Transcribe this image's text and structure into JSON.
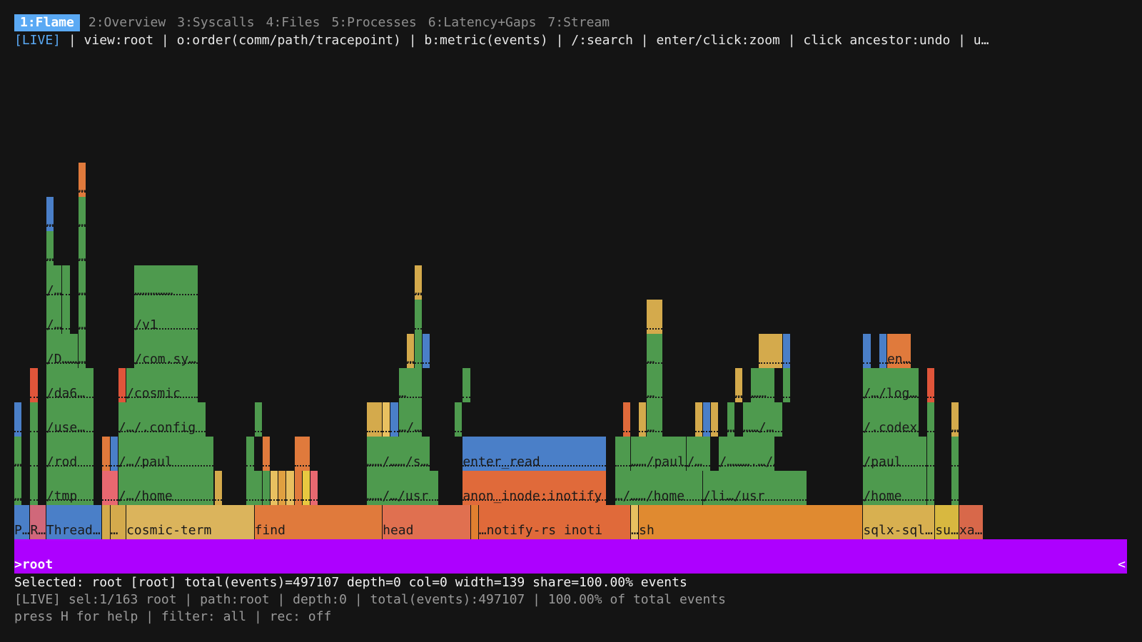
{
  "tabs": [
    {
      "label": "1:Flame",
      "active": true
    },
    {
      "label": "2:Overview",
      "active": false
    },
    {
      "label": "3:Syscalls",
      "active": false
    },
    {
      "label": "4:Files",
      "active": false
    },
    {
      "label": "5:Processes",
      "active": false
    },
    {
      "label": "6:Latency+Gaps",
      "active": false
    },
    {
      "label": "7:Stream",
      "active": false
    }
  ],
  "hint": {
    "live": "[LIVE]",
    "text": " | view:root | o:order(comm/path/tracepoint) | b:metric(events) | /:search | enter/click:zoom | click ancestor:undo | u…"
  },
  "colors": {
    "background": "#141414",
    "tab_active": "#5aa9f4",
    "root": "#ad00ff",
    "green": "#4e9a4e",
    "blue": "#4a7fc8",
    "orange": "#e08030",
    "yellow": "#d4aa4c"
  },
  "flame": {
    "root": {
      "label": ">root",
      "end_marker": "<"
    },
    "frames": [
      {
        "name": "P…",
        "depth": 1,
        "col": 0,
        "w": 2,
        "color": "#4a7fc8"
      },
      {
        "name": "R…",
        "depth": 1,
        "col": 2,
        "w": 2,
        "color": "#d0687a"
      },
      {
        "name": "Thread…",
        "depth": 1,
        "col": 4,
        "w": 7,
        "color": "#4a7fc8"
      },
      {
        "name": "",
        "depth": 1,
        "col": 11,
        "w": 1,
        "color": "#d4aa4c"
      },
      {
        "name": "…",
        "depth": 1,
        "col": 12,
        "w": 2,
        "color": "#d4aa4c"
      },
      {
        "name": "cosmic-term",
        "depth": 1,
        "col": 14,
        "w": 16,
        "color": "#dbb45c"
      },
      {
        "name": "find",
        "depth": 1,
        "col": 30,
        "w": 16,
        "color": "#e07a3c"
      },
      {
        "name": "head",
        "depth": 1,
        "col": 46,
        "w": 11,
        "color": "#e07050"
      },
      {
        "name": "",
        "depth": 1,
        "col": 57,
        "w": 1,
        "color": "#e08030"
      },
      {
        "name": "…notify-rs inoti",
        "depth": 1,
        "col": 58,
        "w": 19,
        "color": "#e06a3a"
      },
      {
        "name": "…",
        "depth": 1,
        "col": 77,
        "w": 1,
        "color": "#e8c060"
      },
      {
        "name": "sh",
        "depth": 1,
        "col": 78,
        "w": 28,
        "color": "#e08a30"
      },
      {
        "name": "sqlx-sql…",
        "depth": 1,
        "col": 106,
        "w": 9,
        "color": "#d8b050"
      },
      {
        "name": "su…",
        "depth": 1,
        "col": 115,
        "w": 3,
        "color": "#d8b840"
      },
      {
        "name": "xa…",
        "depth": 1,
        "col": 118,
        "w": 3,
        "color": "#d8684a"
      },
      {
        "name": "…",
        "depth": 2,
        "col": 0,
        "w": 1,
        "color": "#4e9a4e"
      },
      {
        "name": "",
        "depth": 2,
        "col": 2,
        "w": 1,
        "color": "#4e9a4e"
      },
      {
        "name": "/tmp",
        "depth": 2,
        "col": 4,
        "w": 6,
        "color": "#4e9a4e"
      },
      {
        "name": "",
        "depth": 2,
        "col": 11,
        "w": 2,
        "color": "#e86870"
      },
      {
        "name": "/…/home",
        "depth": 2,
        "col": 13,
        "w": 12,
        "color": "#4e9a4e"
      },
      {
        "name": "",
        "depth": 2,
        "col": 25,
        "w": 1,
        "color": "#d4aa4c"
      },
      {
        "name": "",
        "depth": 2,
        "col": 29,
        "w": 2,
        "color": "#4e9a4e"
      },
      {
        "name": "",
        "depth": 2,
        "col": 31,
        "w": 1,
        "color": "#4e9a4e"
      },
      {
        "name": "",
        "depth": 2,
        "col": 32,
        "w": 1,
        "color": "#e8c060"
      },
      {
        "name": "",
        "depth": 2,
        "col": 33,
        "w": 1,
        "color": "#e0a040"
      },
      {
        "name": "",
        "depth": 2,
        "col": 34,
        "w": 1,
        "color": "#e8c060"
      },
      {
        "name": "",
        "depth": 2,
        "col": 35,
        "w": 1,
        "color": "#e07a3c"
      },
      {
        "name": "",
        "depth": 2,
        "col": 36,
        "w": 1,
        "color": "#e8c840"
      },
      {
        "name": "",
        "depth": 2,
        "col": 37,
        "w": 1,
        "color": "#e86870"
      },
      {
        "name": "……/…/usr",
        "depth": 2,
        "col": 44,
        "w": 9,
        "color": "#4e9a4e"
      },
      {
        "name": "anon_inode:inotify",
        "depth": 2,
        "col": 56,
        "w": 18,
        "color": "#e06a3a"
      },
      {
        "name": "…/……/home",
        "depth": 2,
        "col": 75,
        "w": 11,
        "color": "#4e9a4e"
      },
      {
        "name": "/li…/usr",
        "depth": 2,
        "col": 86,
        "w": 13,
        "color": "#4e9a4e"
      },
      {
        "name": "/home",
        "depth": 2,
        "col": 106,
        "w": 8,
        "color": "#4e9a4e"
      },
      {
        "name": "",
        "depth": 2,
        "col": 114,
        "w": 1,
        "color": "#4e9a4e"
      },
      {
        "name": "",
        "depth": 2,
        "col": 117,
        "w": 1,
        "color": "#4e9a4e"
      },
      {
        "name": "…",
        "depth": 3,
        "col": 0,
        "w": 1,
        "color": "#4e9a4e"
      },
      {
        "name": "",
        "depth": 3,
        "col": 2,
        "w": 1,
        "color": "#4e9a4e"
      },
      {
        "name": "/rod",
        "depth": 3,
        "col": 4,
        "w": 6,
        "color": "#4e9a4e"
      },
      {
        "name": "",
        "depth": 3,
        "col": 11,
        "w": 1,
        "color": "#e07a3c"
      },
      {
        "name": "",
        "depth": 3,
        "col": 12,
        "w": 1,
        "color": "#4a7fc8"
      },
      {
        "name": "/…/paul",
        "depth": 3,
        "col": 13,
        "w": 12,
        "color": "#4e9a4e"
      },
      {
        "name": "",
        "depth": 3,
        "col": 29,
        "w": 1,
        "color": "#4e9a4e"
      },
      {
        "name": "",
        "depth": 3,
        "col": 31,
        "w": 1,
        "color": "#e07a3c"
      },
      {
        "name": "",
        "depth": 3,
        "col": 35,
        "w": 2,
        "color": "#e07a3c"
      },
      {
        "name": "……/……/s…",
        "depth": 3,
        "col": 44,
        "w": 8,
        "color": "#4e9a4e"
      },
      {
        "name": "enter_read",
        "depth": 3,
        "col": 56,
        "w": 18,
        "color": "#4a7fc8"
      },
      {
        "name": "",
        "depth": 3,
        "col": 75,
        "w": 2,
        "color": "#4e9a4e"
      },
      {
        "name": "……/paul",
        "depth": 3,
        "col": 77,
        "w": 7,
        "color": "#4e9a4e"
      },
      {
        "name": "/…",
        "depth": 3,
        "col": 84,
        "w": 3,
        "color": "#4e9a4e"
      },
      {
        "name": "/……….…/…",
        "depth": 3,
        "col": 88,
        "w": 7,
        "color": "#4e9a4e"
      },
      {
        "name": "/paul",
        "depth": 3,
        "col": 106,
        "w": 8,
        "color": "#4e9a4e"
      },
      {
        "name": "",
        "depth": 3,
        "col": 114,
        "w": 1,
        "color": "#4e9a4e"
      },
      {
        "name": "",
        "depth": 3,
        "col": 117,
        "w": 1,
        "color": "#4e9a4e"
      },
      {
        "name": "",
        "depth": 4,
        "col": 0,
        "w": 1,
        "color": "#4a7fc8"
      },
      {
        "name": "",
        "depth": 4,
        "col": 2,
        "w": 1,
        "color": "#4e9a4e"
      },
      {
        "name": "/use…",
        "depth": 4,
        "col": 4,
        "w": 6,
        "color": "#4e9a4e"
      },
      {
        "name": "/…/.config",
        "depth": 4,
        "col": 13,
        "w": 11,
        "color": "#4e9a4e"
      },
      {
        "name": "",
        "depth": 4,
        "col": 30,
        "w": 1,
        "color": "#4e9a4e"
      },
      {
        "name": "",
        "depth": 4,
        "col": 44,
        "w": 2,
        "color": "#d4aa4c"
      },
      {
        "name": "",
        "depth": 4,
        "col": 46,
        "w": 1,
        "color": "#e8c060"
      },
      {
        "name": "",
        "depth": 4,
        "col": 47,
        "w": 1,
        "color": "#4a7fc8"
      },
      {
        "name": "…/…",
        "depth": 4,
        "col": 48,
        "w": 3,
        "color": "#4e9a4e"
      },
      {
        "name": "",
        "depth": 4,
        "col": 55,
        "w": 1,
        "color": "#4e9a4e"
      },
      {
        "name": "",
        "depth": 4,
        "col": 76,
        "w": 1,
        "color": "#e06a3a"
      },
      {
        "name": "",
        "depth": 4,
        "col": 78,
        "w": 1,
        "color": "#d4aa4c"
      },
      {
        "name": "…",
        "depth": 4,
        "col": 79,
        "w": 2,
        "color": "#4e9a4e"
      },
      {
        "name": "",
        "depth": 4,
        "col": 85,
        "w": 1,
        "color": "#d4aa4c"
      },
      {
        "name": "",
        "depth": 4,
        "col": 86,
        "w": 1,
        "color": "#4a7fc8"
      },
      {
        "name": "",
        "depth": 4,
        "col": 87,
        "w": 1,
        "color": "#d4aa4c"
      },
      {
        "name": "…",
        "depth": 4,
        "col": 89,
        "w": 1,
        "color": "#4e9a4e"
      },
      {
        "name": "……/…",
        "depth": 4,
        "col": 91,
        "w": 5,
        "color": "#4e9a4e"
      },
      {
        "name": "/.codex",
        "depth": 4,
        "col": 106,
        "w": 7,
        "color": "#4e9a4e"
      },
      {
        "name": "",
        "depth": 4,
        "col": 114,
        "w": 1,
        "color": "#4e9a4e"
      },
      {
        "name": "…",
        "depth": 4,
        "col": 117,
        "w": 1,
        "color": "#d4aa4c"
      },
      {
        "name": "",
        "depth": 5,
        "col": 2,
        "w": 1,
        "color": "#e0553a"
      },
      {
        "name": "/da6…",
        "depth": 5,
        "col": 4,
        "w": 6,
        "color": "#4e9a4e"
      },
      {
        "name": "",
        "depth": 5,
        "col": 13,
        "w": 1,
        "color": "#e0553a"
      },
      {
        "name": "/cosmic",
        "depth": 5,
        "col": 14,
        "w": 9,
        "color": "#4e9a4e"
      },
      {
        "name": "…",
        "depth": 5,
        "col": 48,
        "w": 3,
        "color": "#4e9a4e"
      },
      {
        "name": "",
        "depth": 5,
        "col": 56,
        "w": 1,
        "color": "#4e9a4e"
      },
      {
        "name": "…",
        "depth": 5,
        "col": 79,
        "w": 2,
        "color": "#4e9a4e"
      },
      {
        "name": "…",
        "depth": 5,
        "col": 90,
        "w": 1,
        "color": "#d4aa4c"
      },
      {
        "name": "……",
        "depth": 5,
        "col": 92,
        "w": 3,
        "color": "#4e9a4e"
      },
      {
        "name": "",
        "depth": 5,
        "col": 96,
        "w": 1,
        "color": "#4e9a4e"
      },
      {
        "name": "/…/log…",
        "depth": 5,
        "col": 106,
        "w": 7,
        "color": "#4e9a4e"
      },
      {
        "name": "",
        "depth": 5,
        "col": 114,
        "w": 1,
        "color": "#e0553a"
      },
      {
        "name": "/D……",
        "depth": 6,
        "col": 4,
        "w": 4,
        "color": "#4e9a4e"
      },
      {
        "name": "…",
        "depth": 6,
        "col": 8,
        "w": 1,
        "color": "#4e9a4e"
      },
      {
        "name": "/com.sy…",
        "depth": 6,
        "col": 15,
        "w": 8,
        "color": "#4e9a4e"
      },
      {
        "name": "…",
        "depth": 6,
        "col": 49,
        "w": 1,
        "color": "#d4aa4c"
      },
      {
        "name": "",
        "depth": 6,
        "col": 50,
        "w": 1,
        "color": "#4e9a4e"
      },
      {
        "name": "",
        "depth": 6,
        "col": 51,
        "w": 1,
        "color": "#4a7fc8"
      },
      {
        "name": "…",
        "depth": 6,
        "col": 79,
        "w": 2,
        "color": "#4e9a4e"
      },
      {
        "name": "",
        "depth": 6,
        "col": 93,
        "w": 3,
        "color": "#d4aa4c"
      },
      {
        "name": "",
        "depth": 6,
        "col": 96,
        "w": 1,
        "color": "#4a7fc8"
      },
      {
        "name": "",
        "depth": 6,
        "col": 106,
        "w": 1,
        "color": "#4a7fc8"
      },
      {
        "name": "",
        "depth": 6,
        "col": 108,
        "w": 1,
        "color": "#4a7fc8"
      },
      {
        "name": "en…",
        "depth": 6,
        "col": 109,
        "w": 3,
        "color": "#e07a3c"
      },
      {
        "name": "/…",
        "depth": 7,
        "col": 4,
        "w": 2,
        "color": "#4e9a4e"
      },
      {
        "name": "",
        "depth": 7,
        "col": 6,
        "w": 1,
        "color": "#4e9a4e"
      },
      {
        "name": "…",
        "depth": 7,
        "col": 8,
        "w": 1,
        "color": "#4e9a4e"
      },
      {
        "name": "/v1",
        "depth": 7,
        "col": 15,
        "w": 8,
        "color": "#4e9a4e"
      },
      {
        "name": "",
        "depth": 7,
        "col": 50,
        "w": 1,
        "color": "#4e9a4e"
      },
      {
        "name": "",
        "depth": 7,
        "col": 79,
        "w": 2,
        "color": "#d4aa4c"
      },
      {
        "name": "/…",
        "depth": 8,
        "col": 4,
        "w": 2,
        "color": "#4e9a4e"
      },
      {
        "name": "",
        "depth": 8,
        "col": 6,
        "w": 1,
        "color": "#4e9a4e"
      },
      {
        "name": "…",
        "depth": 8,
        "col": 8,
        "w": 1,
        "color": "#4e9a4e"
      },
      {
        "name": "……………",
        "depth": 8,
        "col": 15,
        "w": 8,
        "color": "#4e9a4e"
      },
      {
        "name": "…",
        "depth": 8,
        "col": 50,
        "w": 1,
        "color": "#d4aa4c"
      },
      {
        "name": "…",
        "depth": 9,
        "col": 4,
        "w": 1,
        "color": "#4e9a4e"
      },
      {
        "name": "…",
        "depth": 9,
        "col": 8,
        "w": 1,
        "color": "#4e9a4e"
      },
      {
        "name": "…",
        "depth": 10,
        "col": 4,
        "w": 1,
        "color": "#4a7fc8"
      },
      {
        "name": "…",
        "depth": 10,
        "col": 8,
        "w": 1,
        "color": "#4e9a4e"
      },
      {
        "name": "…",
        "depth": 11,
        "col": 8,
        "w": 1,
        "color": "#e07a3c"
      }
    ]
  },
  "status": {
    "selected": "Selected: root [root] total(events)=497107 depth=0 col=0 width=139 share=100.00% events",
    "line2": "[LIVE] sel:1/163 root | path:root | depth:0 | total(events):497107 | 100.00% of total events",
    "line3": "press H for help | filter: all | rec: off"
  }
}
